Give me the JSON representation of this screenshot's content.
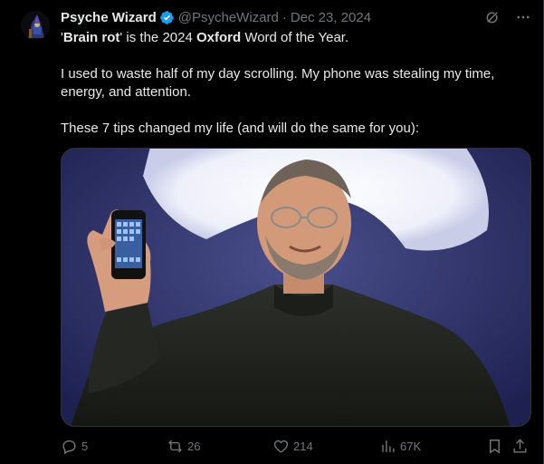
{
  "tweet": {
    "display_name": "Psyche Wizard",
    "handle": "@PsycheWizard",
    "separator": "·",
    "date": "Dec 23, 2024",
    "line1_part1": "'",
    "line1_bold1": "Brain rot",
    "line1_part2": "' is the 2024 ",
    "line1_bold2": "Oxford",
    "line1_part3": " Word of the Year.",
    "paragraph2": "I used to waste half of my day scrolling. My phone was stealing my time, energy, and attention.",
    "paragraph3": "These 7 tips changed my life (and will do the same for you):"
  },
  "actions": {
    "replies": "5",
    "reposts": "26",
    "likes": "214",
    "views": "67K"
  },
  "icons": {
    "verified": "verified-badge-icon",
    "grok": "grok-icon",
    "more": "more-icon",
    "reply": "reply-icon",
    "repost": "repost-icon",
    "like": "heart-icon",
    "views": "views-icon",
    "bookmark": "bookmark-icon",
    "share": "share-icon"
  },
  "colors": {
    "background": "#000000",
    "text": "#e7e9ea",
    "muted": "#71767b",
    "verified": "#1d9bf0"
  }
}
